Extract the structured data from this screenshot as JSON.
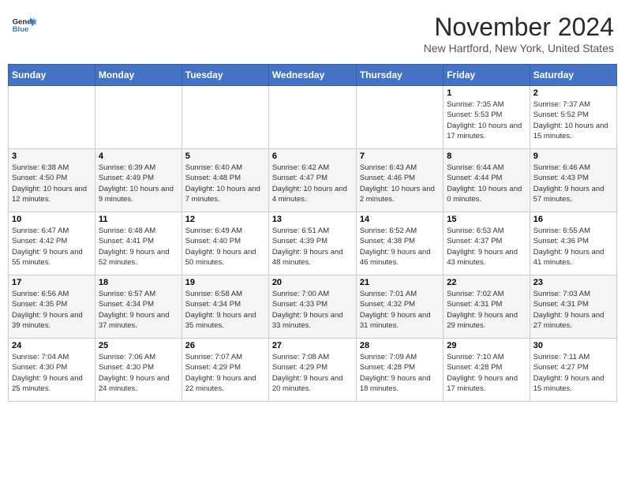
{
  "header": {
    "logo_line1": "General",
    "logo_line2": "Blue",
    "month": "November 2024",
    "location": "New Hartford, New York, United States"
  },
  "weekdays": [
    "Sunday",
    "Monday",
    "Tuesday",
    "Wednesday",
    "Thursday",
    "Friday",
    "Saturday"
  ],
  "weeks": [
    [
      {
        "day": "",
        "info": ""
      },
      {
        "day": "",
        "info": ""
      },
      {
        "day": "",
        "info": ""
      },
      {
        "day": "",
        "info": ""
      },
      {
        "day": "",
        "info": ""
      },
      {
        "day": "1",
        "info": "Sunrise: 7:35 AM\nSunset: 5:53 PM\nDaylight: 10 hours and 17 minutes."
      },
      {
        "day": "2",
        "info": "Sunrise: 7:37 AM\nSunset: 5:52 PM\nDaylight: 10 hours and 15 minutes."
      }
    ],
    [
      {
        "day": "3",
        "info": "Sunrise: 6:38 AM\nSunset: 4:50 PM\nDaylight: 10 hours and 12 minutes."
      },
      {
        "day": "4",
        "info": "Sunrise: 6:39 AM\nSunset: 4:49 PM\nDaylight: 10 hours and 9 minutes."
      },
      {
        "day": "5",
        "info": "Sunrise: 6:40 AM\nSunset: 4:48 PM\nDaylight: 10 hours and 7 minutes."
      },
      {
        "day": "6",
        "info": "Sunrise: 6:42 AM\nSunset: 4:47 PM\nDaylight: 10 hours and 4 minutes."
      },
      {
        "day": "7",
        "info": "Sunrise: 6:43 AM\nSunset: 4:46 PM\nDaylight: 10 hours and 2 minutes."
      },
      {
        "day": "8",
        "info": "Sunrise: 6:44 AM\nSunset: 4:44 PM\nDaylight: 10 hours and 0 minutes."
      },
      {
        "day": "9",
        "info": "Sunrise: 6:46 AM\nSunset: 4:43 PM\nDaylight: 9 hours and 57 minutes."
      }
    ],
    [
      {
        "day": "10",
        "info": "Sunrise: 6:47 AM\nSunset: 4:42 PM\nDaylight: 9 hours and 55 minutes."
      },
      {
        "day": "11",
        "info": "Sunrise: 6:48 AM\nSunset: 4:41 PM\nDaylight: 9 hours and 52 minutes."
      },
      {
        "day": "12",
        "info": "Sunrise: 6:49 AM\nSunset: 4:40 PM\nDaylight: 9 hours and 50 minutes."
      },
      {
        "day": "13",
        "info": "Sunrise: 6:51 AM\nSunset: 4:39 PM\nDaylight: 9 hours and 48 minutes."
      },
      {
        "day": "14",
        "info": "Sunrise: 6:52 AM\nSunset: 4:38 PM\nDaylight: 9 hours and 46 minutes."
      },
      {
        "day": "15",
        "info": "Sunrise: 6:53 AM\nSunset: 4:37 PM\nDaylight: 9 hours and 43 minutes."
      },
      {
        "day": "16",
        "info": "Sunrise: 6:55 AM\nSunset: 4:36 PM\nDaylight: 9 hours and 41 minutes."
      }
    ],
    [
      {
        "day": "17",
        "info": "Sunrise: 6:56 AM\nSunset: 4:35 PM\nDaylight: 9 hours and 39 minutes."
      },
      {
        "day": "18",
        "info": "Sunrise: 6:57 AM\nSunset: 4:34 PM\nDaylight: 9 hours and 37 minutes."
      },
      {
        "day": "19",
        "info": "Sunrise: 6:58 AM\nSunset: 4:34 PM\nDaylight: 9 hours and 35 minutes."
      },
      {
        "day": "20",
        "info": "Sunrise: 7:00 AM\nSunset: 4:33 PM\nDaylight: 9 hours and 33 minutes."
      },
      {
        "day": "21",
        "info": "Sunrise: 7:01 AM\nSunset: 4:32 PM\nDaylight: 9 hours and 31 minutes."
      },
      {
        "day": "22",
        "info": "Sunrise: 7:02 AM\nSunset: 4:31 PM\nDaylight: 9 hours and 29 minutes."
      },
      {
        "day": "23",
        "info": "Sunrise: 7:03 AM\nSunset: 4:31 PM\nDaylight: 9 hours and 27 minutes."
      }
    ],
    [
      {
        "day": "24",
        "info": "Sunrise: 7:04 AM\nSunset: 4:30 PM\nDaylight: 9 hours and 25 minutes."
      },
      {
        "day": "25",
        "info": "Sunrise: 7:06 AM\nSunset: 4:30 PM\nDaylight: 9 hours and 24 minutes."
      },
      {
        "day": "26",
        "info": "Sunrise: 7:07 AM\nSunset: 4:29 PM\nDaylight: 9 hours and 22 minutes."
      },
      {
        "day": "27",
        "info": "Sunrise: 7:08 AM\nSunset: 4:29 PM\nDaylight: 9 hours and 20 minutes."
      },
      {
        "day": "28",
        "info": "Sunrise: 7:09 AM\nSunset: 4:28 PM\nDaylight: 9 hours and 18 minutes."
      },
      {
        "day": "29",
        "info": "Sunrise: 7:10 AM\nSunset: 4:28 PM\nDaylight: 9 hours and 17 minutes."
      },
      {
        "day": "30",
        "info": "Sunrise: 7:11 AM\nSunset: 4:27 PM\nDaylight: 9 hours and 15 minutes."
      }
    ]
  ]
}
